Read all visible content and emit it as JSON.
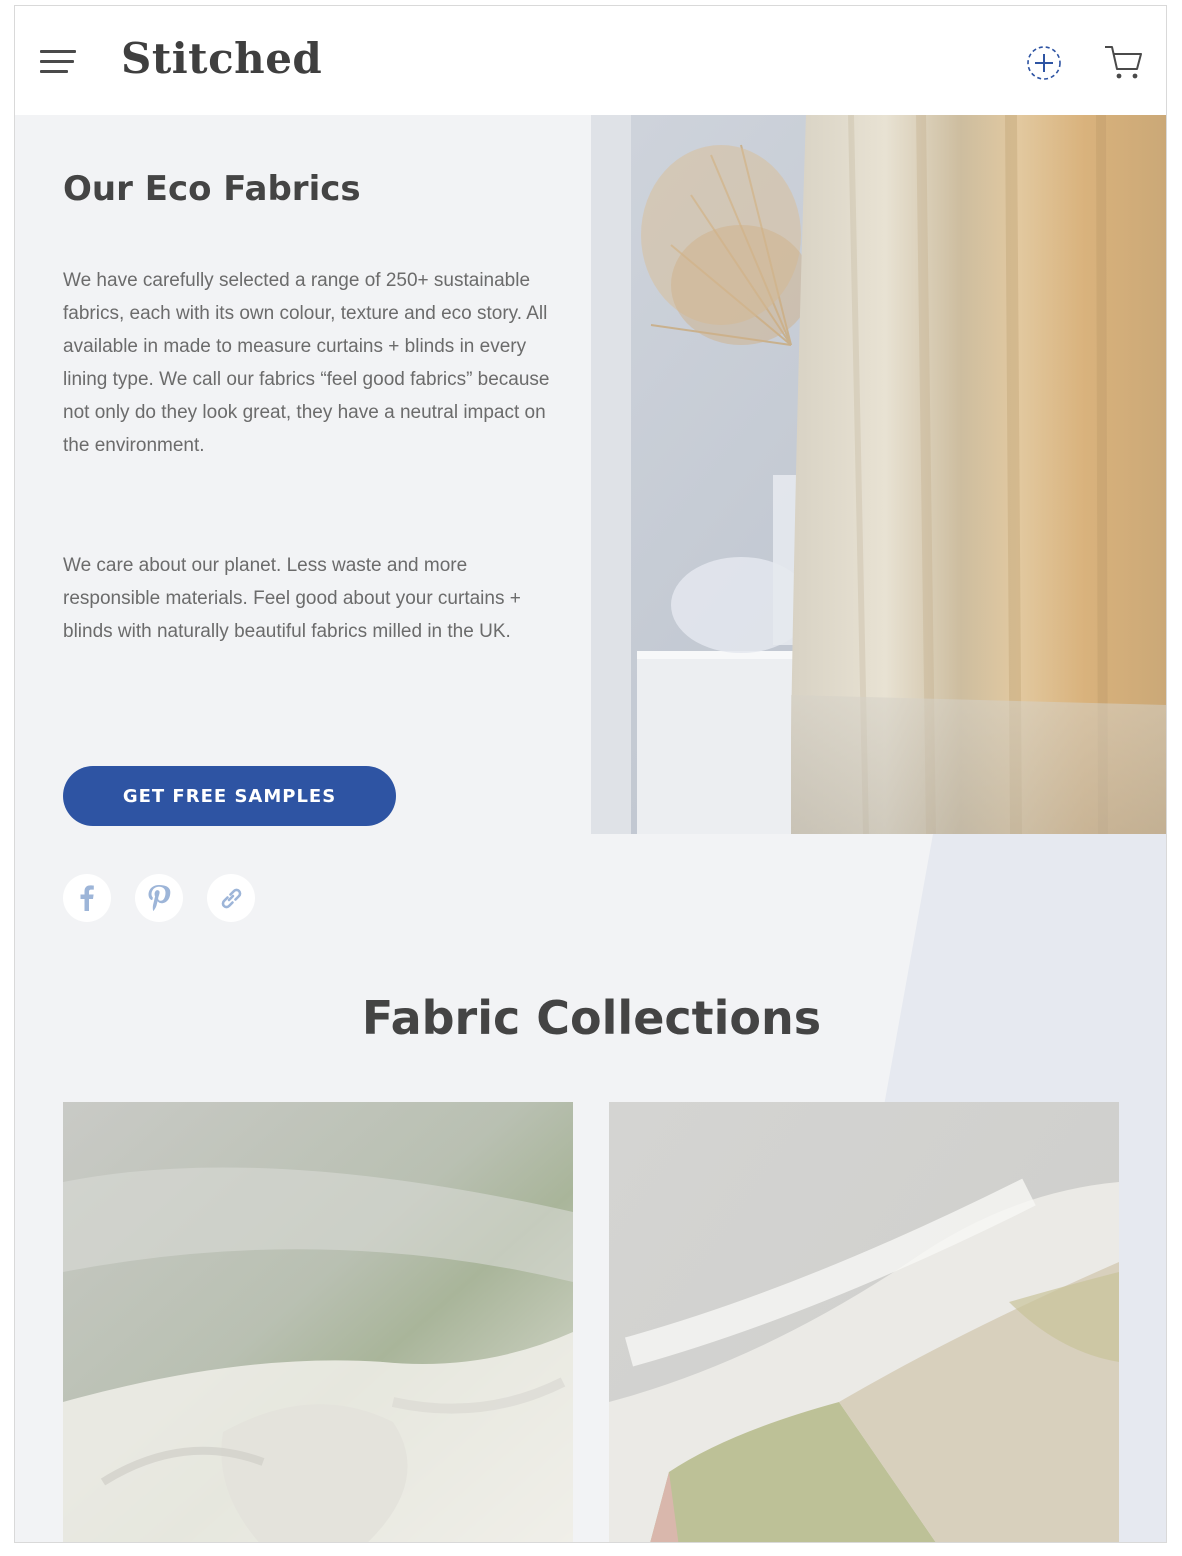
{
  "header": {
    "logo": "Stitched",
    "menu_icon": "hamburger-menu-icon",
    "samples_icon": "add-sample-icon",
    "cart_icon": "cart-icon"
  },
  "hero": {
    "title": "Our Eco Fabrics",
    "paragraph_1": "We have carefully selected a range of 250+ sustainable fabrics, each with its own colour, texture and eco story. All available in made to measure curtains + blinds in every lining type. We call our fabrics “feel good fabrics” because not only do they look great, they have a neutral impact on the environment.",
    "paragraph_2": "We care about our planet. Less waste and more responsible materials. Feel good about your curtains + blinds with naturally beautiful fabrics milled in the UK.",
    "cta_label": "GET FREE SAMPLES"
  },
  "social": [
    {
      "icon": "facebook-icon"
    },
    {
      "icon": "pinterest-icon"
    },
    {
      "icon": "link-icon"
    }
  ],
  "collections": {
    "title": "Fabric Collections"
  },
  "colors": {
    "accent": "#2e54a3",
    "background": "#f2f3f5",
    "text": "#444444",
    "social_icon": "#9db5d8"
  }
}
